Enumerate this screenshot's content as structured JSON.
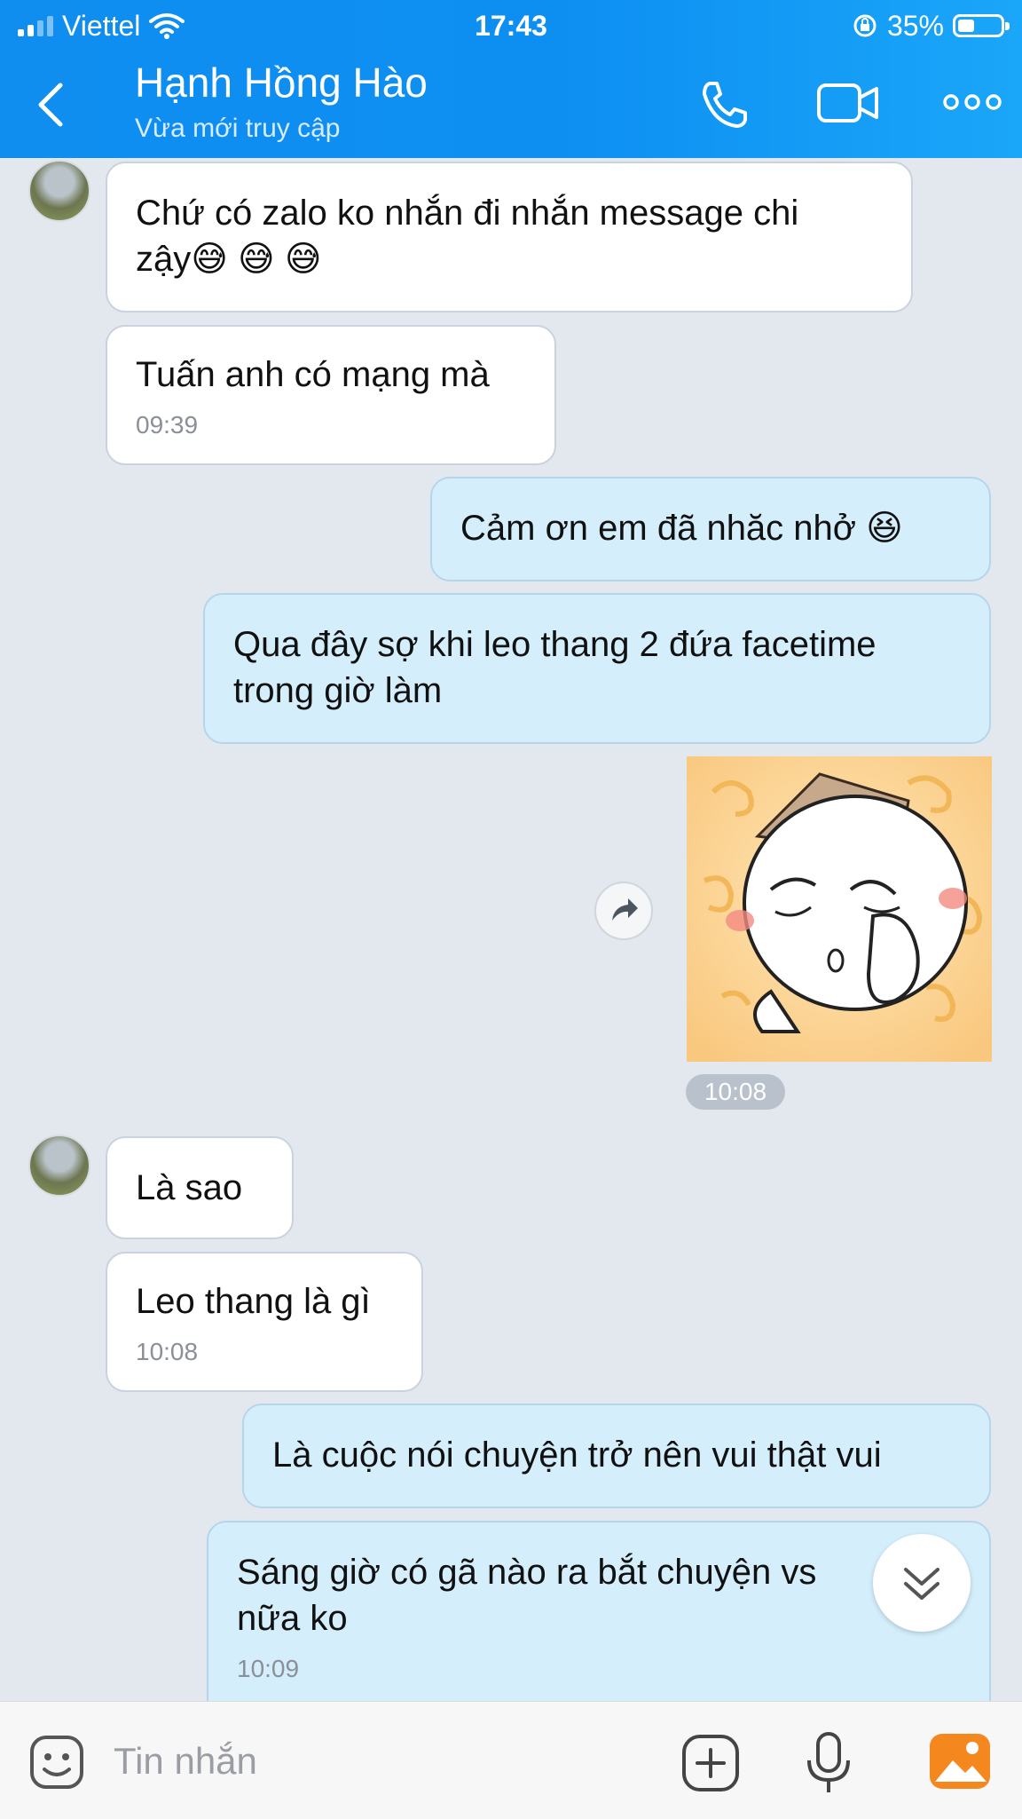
{
  "status_bar": {
    "carrier": "Viettel",
    "time": "17:43",
    "battery": "35%"
  },
  "header": {
    "contact_name": "Hạnh Hồng Hào",
    "contact_status": "Vừa mới truy cập"
  },
  "messages": [
    {
      "from": "contact",
      "text_line1": "Chứ có zalo ko nhắn đi nhắn message chi",
      "text_line2": "zậy😅 😅 😅"
    },
    {
      "from": "contact",
      "text": "Tuấn anh có mạng mà",
      "time": "09:39"
    },
    {
      "from": "me",
      "text": "Cảm ơn em đã nhăc nhở 😆"
    },
    {
      "from": "me",
      "text_line1": "Qua đây sợ khi leo thang 2 đứa facetime",
      "text_line2": "trong giờ làm"
    },
    {
      "from": "me",
      "type": "sticker",
      "time": "10:08"
    },
    {
      "from": "contact",
      "text": "Là sao"
    },
    {
      "from": "contact",
      "text": "Leo thang là gì",
      "time": "10:08"
    },
    {
      "from": "me",
      "text": "Là cuộc nói chuyện trở nên vui thật vui"
    },
    {
      "from": "me",
      "text_line1": "Sáng giờ có gã nào ra bắt chuyện vs",
      "text_line2": "nữa ko",
      "time": "10:09"
    }
  ],
  "composer": {
    "placeholder": "Tin nhắn"
  },
  "icons": {
    "back": "chevron-left-icon",
    "call": "phone-icon",
    "video": "video-camera-icon",
    "more": "more-dots-icon",
    "sticker": "sticker-face-icon",
    "attach": "plus-square-icon",
    "voice": "microphone-icon",
    "gallery": "image-gallery-icon",
    "share": "share-arrow-icon",
    "scroll": "double-chevron-down-icon"
  },
  "colors": {
    "header": "#0d8ff2",
    "outgoing_bubble": "#d4eefc",
    "incoming_bubble": "#ffffff",
    "chat_background": "#e3e7ee",
    "gallery_icon": "#f5871f"
  }
}
